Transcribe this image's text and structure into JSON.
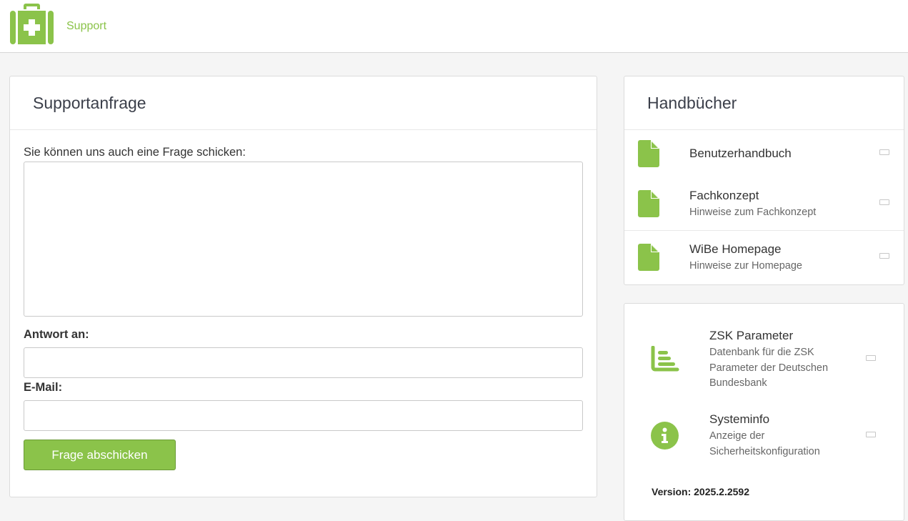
{
  "header": {
    "brand": "Support",
    "icon": "medical-kit-icon",
    "accent": "#8bc34a"
  },
  "support_form": {
    "title": "Supportanfrage",
    "question_label": "Sie können uns auch eine Frage schicken:",
    "question_value": "",
    "reply_label": "Antwort an:",
    "reply_value": "",
    "email_label": "E-Mail:",
    "email_value": "",
    "submit_label": "Frage abschicken"
  },
  "manuals": {
    "title": "Handbücher",
    "items": [
      {
        "title": "Benutzerhandbuch",
        "subtitle": "",
        "icon": "document-icon"
      },
      {
        "title": "Fachkonzept",
        "subtitle": "Hinweise zum Fachkonzept",
        "icon": "document-icon"
      },
      {
        "title": "WiBe Homepage",
        "subtitle": "Hinweise zur Homepage",
        "icon": "document-icon"
      }
    ]
  },
  "tools": {
    "items": [
      {
        "title": "ZSK Parameter",
        "subtitle": "Datenbank für die ZSK Parameter der Deutschen Bundesbank",
        "icon": "bar-chart-icon"
      },
      {
        "title": "Systeminfo",
        "subtitle": "Anzeige der Sicherheitskonfiguration",
        "icon": "info-icon"
      }
    ],
    "version": "Version: 2025.2.2592"
  }
}
